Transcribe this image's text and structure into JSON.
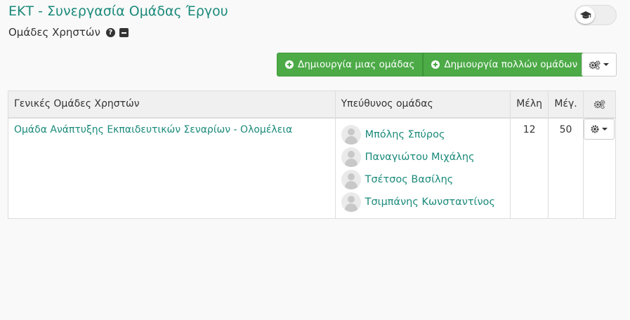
{
  "course": {
    "title": "ΕΚΤ - Συνεργασία Ομάδας Έργου",
    "subtitle": "Ομάδες Χρηστών"
  },
  "icons": {
    "help": "question-circle-icon",
    "collapse": "minus-square-icon",
    "toggle": "graduation-cap-icon",
    "gears": "gears-icon",
    "gear": "gear-icon",
    "plus": "plus-circle-icon"
  },
  "toolbar": {
    "create_one_label": "Δημιουργία μιας ομάδας",
    "create_many_label": "Δημιουργία πολλών ομάδων"
  },
  "table": {
    "headers": {
      "name": "Γενικές Ομάδες Χρηστών",
      "lead": "Υπεύθυνος ομάδας",
      "members": "Μέλη",
      "max": "Μέγ."
    },
    "rows": [
      {
        "name": "Ομάδα Ανάπτυξης Εκπαιδευτικών Σεναρίων - Ολομέλεια",
        "leads": [
          "Μπόλης Σπύρος",
          "Παναγιώτου Μιχάλης",
          "Τσέτσος Βασίλης",
          "Τσιμπάνης Κωνσταντίνος"
        ],
        "members": "12",
        "max": "50"
      }
    ]
  },
  "colors": {
    "accent": "#1a8a7a",
    "button_green": "#4caa47",
    "background": "#f9f9f9"
  }
}
